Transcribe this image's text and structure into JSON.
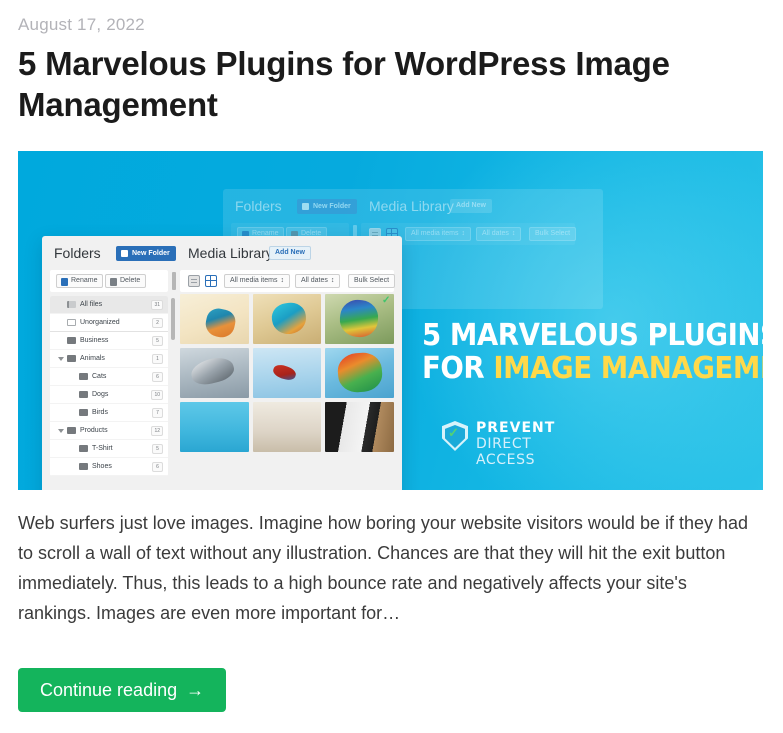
{
  "post": {
    "date": "August 17, 2022",
    "title": "5 Marvelous Plugins for WordPress Image Management",
    "excerpt": "Web surfers just love images. Imagine how boring your website visitors would be if they had to scroll a wall of text without any illustration. Chances are that they will hit the exit button immediately. Thus, this leads to a high bounce rate and negatively affects your site's rankings. Images are even more important for…",
    "read_more_label": "Continue reading",
    "read_more_arrow": "→"
  },
  "banner": {
    "promo_line1": "5 Marvelous Plugins",
    "promo_line2_prefix": "For ",
    "promo_line2_highlight": "Image Management",
    "logo_line1": "PREVENT",
    "logo_line2": "DIRECT ACCESS",
    "colors": {
      "background": "#00a9dd",
      "highlight_text": "#ffd94a",
      "promo_text": "#ffffff"
    }
  },
  "mockup": {
    "folders_title": "Folders",
    "new_folder_label": "New Folder",
    "rename_label": "Rename",
    "delete_label": "Delete",
    "media_library_title": "Media Library",
    "add_new_label": "Add New",
    "filter_media_items": "All media items",
    "filter_dates": "All dates",
    "bulk_select_label": "Bulk Select",
    "tree": [
      {
        "label": "All files",
        "count": "31",
        "depth": 0,
        "icon": "file-icon",
        "selected": true,
        "caret": false
      },
      {
        "label": "Unorganized",
        "count": "2",
        "depth": 0,
        "icon": "box-icon",
        "selected": false,
        "caret": false
      },
      {
        "label": "Business",
        "count": "5",
        "depth": 0,
        "icon": "folder-icon",
        "selected": false,
        "caret": false
      },
      {
        "label": "Animals",
        "count": "1",
        "depth": 0,
        "icon": "folder-icon",
        "selected": false,
        "caret": true
      },
      {
        "label": "Cats",
        "count": "6",
        "depth": 1,
        "icon": "folder-icon",
        "selected": false,
        "caret": false
      },
      {
        "label": "Dogs",
        "count": "10",
        "depth": 1,
        "icon": "folder-icon",
        "selected": false,
        "caret": false
      },
      {
        "label": "Birds",
        "count": "7",
        "depth": 1,
        "icon": "folder-icon",
        "selected": false,
        "caret": false
      },
      {
        "label": "Products",
        "count": "12",
        "depth": 0,
        "icon": "folder-icon",
        "selected": false,
        "caret": true
      },
      {
        "label": "T-Shirt",
        "count": "5",
        "depth": 1,
        "icon": "folder-icon",
        "selected": false,
        "caret": false
      },
      {
        "label": "Shoes",
        "count": "6",
        "depth": 1,
        "icon": "folder-icon",
        "selected": false,
        "caret": false
      }
    ],
    "thumbnails": [
      {
        "name": "kingfisher-perched",
        "selected": false
      },
      {
        "name": "kingfisher-closeup",
        "selected": false
      },
      {
        "name": "rainbow-lorikeet",
        "selected": true
      },
      {
        "name": "bird-taking-flight",
        "selected": false
      },
      {
        "name": "macaw-in-flight",
        "selected": false
      },
      {
        "name": "scarlet-macaw",
        "selected": false
      },
      {
        "name": "birds-over-sea",
        "selected": false
      },
      {
        "name": "bird-on-sand",
        "selected": false
      },
      {
        "name": "black-white-bird",
        "selected": false
      }
    ],
    "selected_check": "✓"
  }
}
